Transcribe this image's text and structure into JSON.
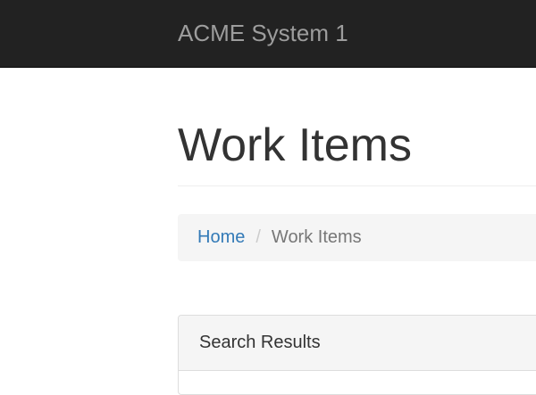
{
  "navbar": {
    "brand": "ACME System 1"
  },
  "page": {
    "title": "Work Items"
  },
  "breadcrumb": {
    "home": "Home",
    "separator": "/",
    "current": "Work Items"
  },
  "panel": {
    "heading": "Search Results"
  },
  "colors": {
    "navbar_bg": "#222222",
    "brand_text": "#9d9d9d",
    "link": "#337ab7",
    "breadcrumb_bg": "#f5f5f5",
    "panel_border": "#dddddd"
  }
}
